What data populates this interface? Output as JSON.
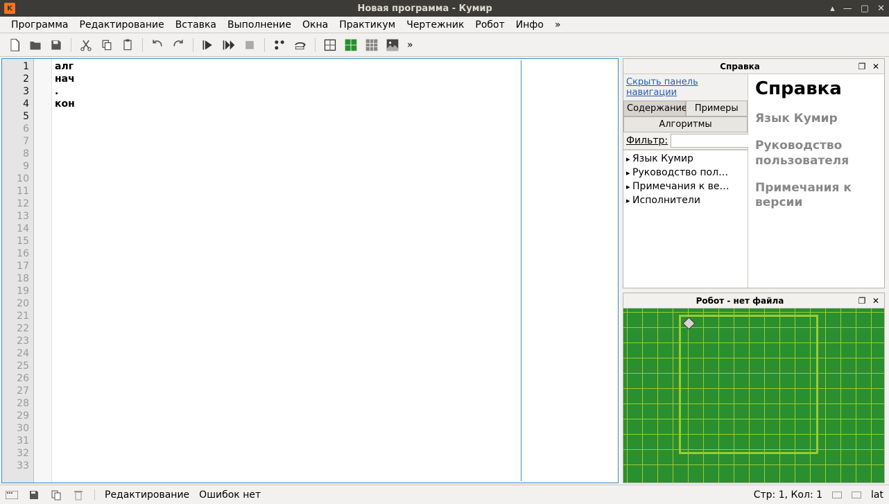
{
  "window": {
    "title": "Новая программа - Кумир",
    "app_icon_letter": "K"
  },
  "menubar": {
    "items": [
      "Программа",
      "Редактирование",
      "Вставка",
      "Выполнение",
      "Окна",
      "Практикум",
      "Чертежник",
      "Робот",
      "Инфо",
      "»"
    ]
  },
  "editor": {
    "lines": [
      "алг",
      "нач",
      ".",
      "кон",
      ""
    ],
    "total_gutter_lines": 33
  },
  "help_panel": {
    "title": "Справка",
    "hide_nav": "Скрыть панель навигации",
    "tabs": [
      "Содержание",
      "Примеры",
      "Алгоритмы"
    ],
    "active_tab": 0,
    "filter_label": "Фильтр:",
    "filter_value": "",
    "tree": [
      "Язык Кумир",
      "Руководство пол…",
      "Примечания к ве…",
      "Исполнители"
    ],
    "content_title": "Справка",
    "sections": [
      "Язык Кумир",
      "Руководство пользователя",
      "Примечания к версии"
    ]
  },
  "robot_panel": {
    "title": "Робот - нет файла"
  },
  "statusbar": {
    "mode": "Редактирование",
    "errors": "Ошибок нет",
    "position": "Стр: 1, Кол: 1",
    "layout": "lat"
  }
}
